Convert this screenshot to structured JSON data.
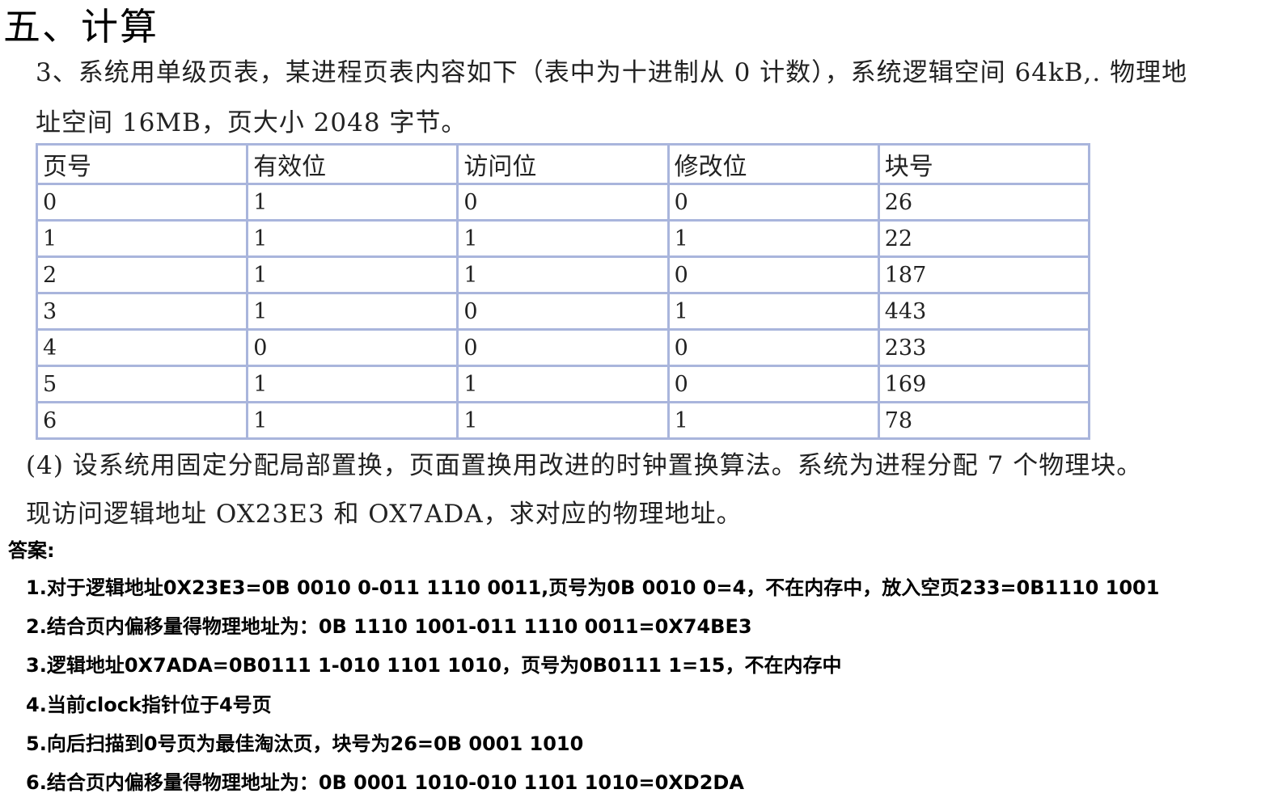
{
  "heading": "五、计算",
  "problem": {
    "line1": "3、系统用单级页表，某进程页表内容如下（表中为十进制从 0 计数），系统逻辑空间 64kB,. 物理地",
    "line2": "址空间 16MB，页大小 2048 字节。",
    "question_line1": "(4)  设系统用固定分配局部置换，页面置换用改进的时钟置换算法。系统为进程分配 7 个物理块。",
    "question_line2": "现访问逻辑地址 OX23E3 和 OX7ADA，求对应的物理地址。"
  },
  "table": {
    "headers": [
      "页号",
      "有效位",
      "访问位",
      "修改位",
      "块号"
    ],
    "rows": [
      [
        "0",
        "1",
        "0",
        "0",
        "26"
      ],
      [
        "1",
        "1",
        "1",
        "1",
        "22"
      ],
      [
        "2",
        "1",
        "1",
        "0",
        "187"
      ],
      [
        "3",
        "1",
        "0",
        "1",
        "443"
      ],
      [
        "4",
        "0",
        "0",
        "0",
        "233"
      ],
      [
        "5",
        "1",
        "1",
        "0",
        "169"
      ],
      [
        "6",
        "1",
        "1",
        "1",
        "78"
      ]
    ]
  },
  "answer": {
    "label": "答案:",
    "lines": [
      "1.对于逻辑地址0X23E3=0B 0010 0-011 1110 0011,页号为0B 0010 0=4，不在内存中，放入空页233=0B1110 1001",
      "2.结合页内偏移量得物理地址为：0B 1110 1001-011 1110 0011=0X74BE3",
      "3.逻辑地址0X7ADA=0B0111 1-010 1101 1010，页号为0B0111 1=15，不在内存中",
      "4.当前clock指针位于4号页",
      "5.向后扫描到0号页为最佳淘汰页，块号为26=0B 0001 1010",
      "6.结合页内偏移量得物理地址为：0B 0001 1010-010 1101 1010=0XD2DA"
    ]
  },
  "colors": {
    "table_border": "#a9b5dc"
  }
}
